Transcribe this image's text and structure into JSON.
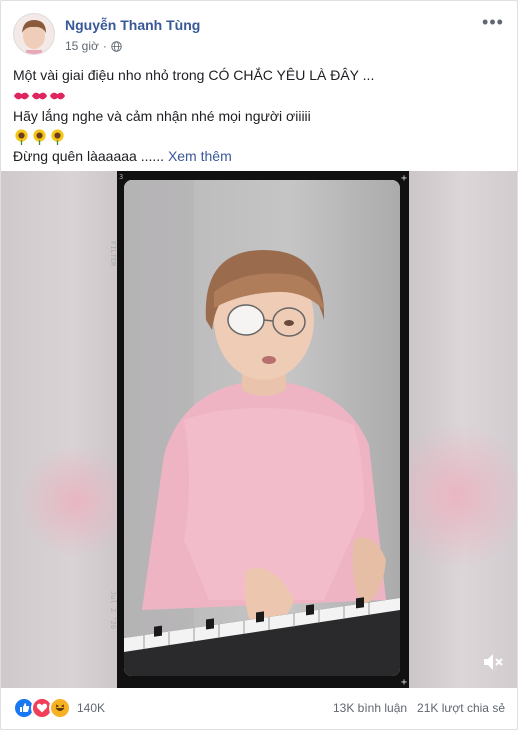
{
  "post": {
    "author": "Nguyễn Thanh Tùng",
    "time": "15 giờ",
    "lines": [
      "Một vài giai điệu nho nhỏ trong CÓ CHẮC YÊU LÀ ĐÂY ...",
      "Hãy lắng nghe và cảm nhận nhé mọi người ơiiiii",
      "Đừng quên làaaaaa ......"
    ],
    "see_more": "Xem thêm"
  },
  "video": {
    "side_left": "3",
    "side_bottom": "Jul 2 '20",
    "side_top": "FILTER"
  },
  "stats": {
    "reactions_count": "140K",
    "comments": "13K bình luận",
    "shares": "21K lượt chia sẻ"
  },
  "icons": {
    "more": "more-options-icon",
    "globe": "globe-icon",
    "kiss": "kiss-mark-icon",
    "sunflower": "sunflower-icon",
    "mute": "speaker-muted-icon",
    "like": "like-reaction-icon",
    "love": "love-reaction-icon",
    "haha": "haha-reaction-icon"
  },
  "colors": {
    "link": "#385898",
    "like": "#1877f2",
    "love": "#f33e58",
    "haha": "#f7b125"
  }
}
